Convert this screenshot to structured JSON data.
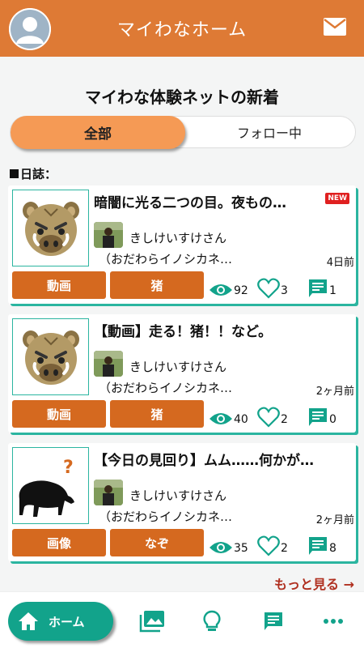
{
  "header": {
    "title": "マイわなホーム"
  },
  "section_title": "マイわな体験ネットの新着",
  "segments": {
    "all": "全部",
    "following": "フォロー中"
  },
  "subheading": "日誌：",
  "posts": [
    {
      "title": "暗闇に光る二つの目。夜もの…",
      "is_new": true,
      "new_label": "NEW",
      "user": "きしけいすけさん",
      "group": "（おだわらイノシカネ…",
      "time": "4日前",
      "tag1": "動画",
      "tag2": "猪",
      "views": "92",
      "likes": "3",
      "comments": "1",
      "thumbnail": "boar-face-icon"
    },
    {
      "title": "【動画】走る！猪！！など。",
      "is_new": false,
      "user": "きしけいすけさん",
      "group": "（おだわらイノシカネ…",
      "time": "2ヶ月前",
      "tag1": "動画",
      "tag2": "猪",
      "views": "40",
      "likes": "2",
      "comments": "0",
      "thumbnail": "boar-face-icon"
    },
    {
      "title": "【今日の見回り】ムム……何かが…",
      "is_new": false,
      "user": "きしけいすけさん",
      "group": "（おだわらイノシカネ…",
      "time": "2ヶ月前",
      "tag1": "画像",
      "tag2": "なぞ",
      "views": "35",
      "likes": "2",
      "comments": "8",
      "thumbnail": "boar-silhouette-question-icon"
    }
  ],
  "more_link": "もっと見る →",
  "bottom_nav": {
    "home_label": "ホーム"
  },
  "colors": {
    "header": "#de7a35",
    "tag": "#d5691f",
    "teal": "#12a38b",
    "accent_border": "#2bb5a0",
    "more": "#b03020"
  }
}
